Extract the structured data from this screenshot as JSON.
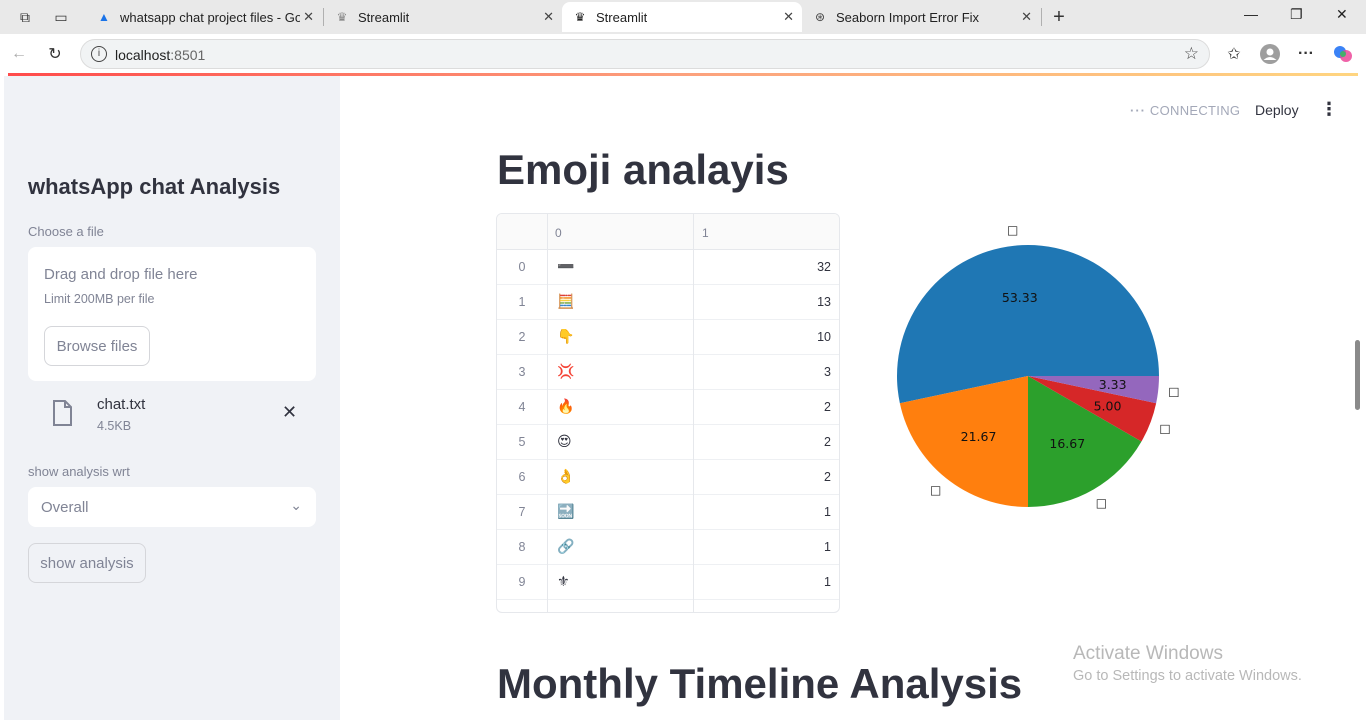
{
  "browser": {
    "tabs": [
      {
        "title": "whatsapp chat project files - Goo",
        "icon": "google-drive-icon"
      },
      {
        "title": "Streamlit",
        "icon": "streamlit-icon"
      },
      {
        "title": "Streamlit",
        "icon": "streamlit-icon",
        "active": true
      },
      {
        "title": "Seaborn Import Error Fix",
        "icon": "openai-icon"
      }
    ],
    "url_host": "localhost",
    "url_port": ":8501"
  },
  "sidebar": {
    "title": "whatsApp chat Analysis",
    "file_label": "Choose a file",
    "drag_text": "Drag and drop file here",
    "limit_text": "Limit 200MB per file",
    "browse_label": "Browse files",
    "file_name": "chat.txt",
    "file_size": "4.5KB",
    "select_label": "show analysis wrt",
    "select_value": "Overall",
    "button_label": "show analysis"
  },
  "main": {
    "status": "CONNECTING",
    "deploy": "Deploy",
    "emoji_heading": "Emoji analayis",
    "monthly_heading": "Monthly Timeline Analysis",
    "table": {
      "columns": [
        "0",
        "1"
      ],
      "rows": [
        {
          "idx": "0",
          "emoji": "➖",
          "count": "32"
        },
        {
          "idx": "1",
          "emoji": "🧮",
          "count": "13"
        },
        {
          "idx": "2",
          "emoji": "👇",
          "count": "10"
        },
        {
          "idx": "3",
          "emoji": "💢",
          "count": "3"
        },
        {
          "idx": "4",
          "emoji": "🔥",
          "count": "2"
        },
        {
          "idx": "5",
          "emoji": "😍",
          "count": "2"
        },
        {
          "idx": "6",
          "emoji": "👌",
          "count": "2"
        },
        {
          "idx": "7",
          "emoji": "🔜",
          "count": "1"
        },
        {
          "idx": "8",
          "emoji": "🔗",
          "count": "1"
        },
        {
          "idx": "9",
          "emoji": "⚜",
          "count": "1"
        }
      ]
    }
  },
  "chart_data": {
    "type": "pie",
    "categories": [
      "□",
      "□",
      "□",
      "□",
      "□"
    ],
    "values": [
      53.33,
      21.67,
      16.67,
      5.0,
      3.33
    ],
    "labels": [
      "53.33",
      "21.67",
      "16.67",
      "5.00",
      "3.33"
    ],
    "colors": [
      "#1f77b4",
      "#ff7f0e",
      "#2ca02c",
      "#d62728",
      "#9467bd"
    ]
  },
  "watermark": {
    "line1": "Activate Windows",
    "line2": "Go to Settings to activate Windows."
  }
}
